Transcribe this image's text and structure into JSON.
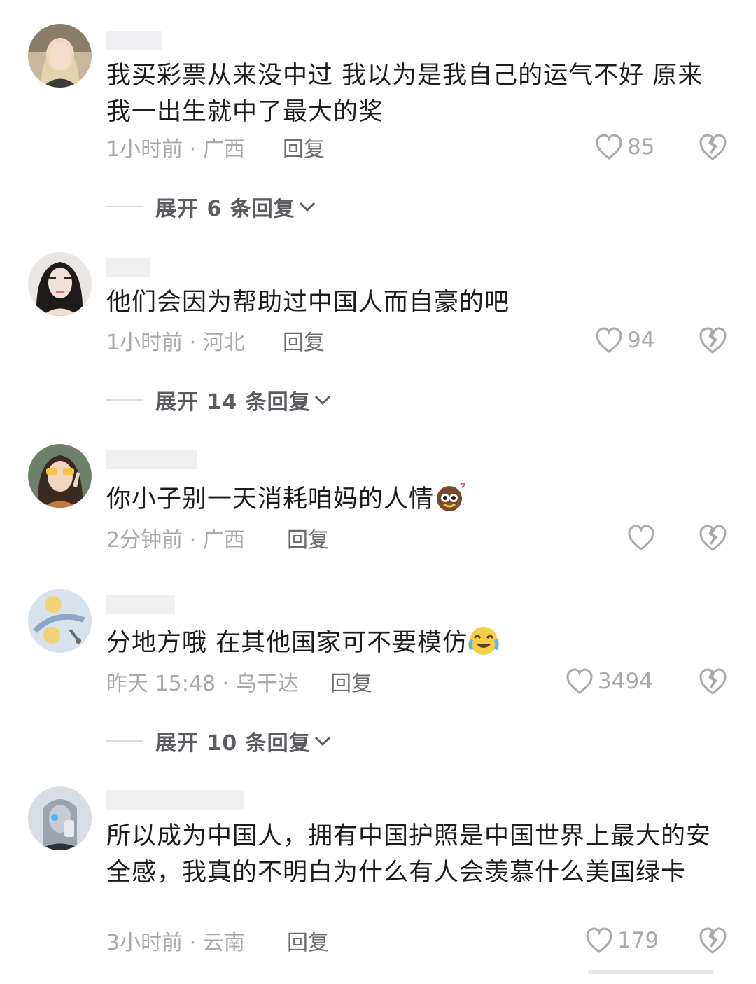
{
  "comments": [
    {
      "text": "我买彩票从来没中过 我以为是我自己的运气不好 原来我一出生就中了最大的奖",
      "time": "1小时前 · 广西",
      "reply": "回复",
      "likes": "85",
      "expand": "展开 6 条回复"
    },
    {
      "text": "他们会因为帮助过中国人而自豪的吧",
      "time": "1小时前 · 河北",
      "reply": "回复",
      "likes": "94",
      "expand": "展开 14 条回复"
    },
    {
      "text": "你小子别一天消耗咱妈的人情",
      "emoji": "sweating-emoji",
      "time": "2分钟前 · 广西",
      "reply": "回复",
      "likes": ""
    },
    {
      "text": "分地方哦 在其他国家可不要模仿",
      "emoji": "crying-laughing-emoji",
      "time": "昨天 15:48 · 乌干达",
      "reply": "回复",
      "likes": "3494",
      "expand": "展开 10 条回复"
    },
    {
      "text": "所以成为中国人，拥有中国护照是中国世界上最大的安全感，我真的不明白为什么有人会羡慕什么美国绿卡",
      "time": "3小时前 · 云南",
      "reply": "回复",
      "likes": "179"
    }
  ],
  "icons": {
    "like": "heart-outline-icon",
    "dislike": "broken-heart-icon",
    "expand": "chevron-down-icon"
  },
  "colors": {
    "text": "#1c1c1e",
    "meta": "#a8a8ad",
    "expand": "#5b5b61"
  }
}
